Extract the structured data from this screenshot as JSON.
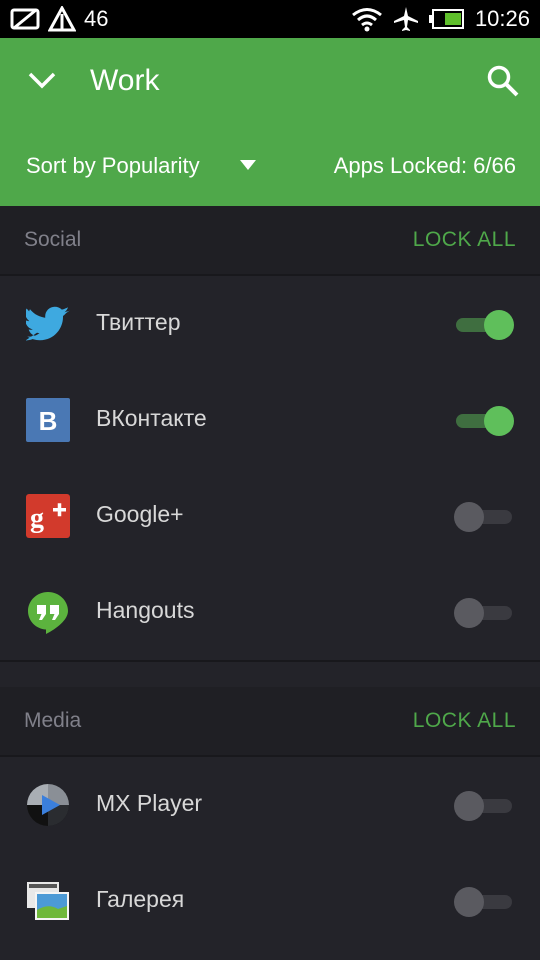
{
  "status_bar": {
    "network": "46",
    "time": "10:26",
    "icons": [
      "screen-off-icon",
      "signal-icon",
      "wifi-icon",
      "airplane-icon",
      "battery-icon"
    ]
  },
  "app_bar": {
    "title": "Work",
    "sort_label": "Sort by Popularity",
    "apps_locked": "Apps Locked: 6/66",
    "color": "#4fa84a"
  },
  "sections": [
    {
      "title": "Social",
      "action": "LOCK ALL",
      "apps": [
        {
          "name": "Твиттер",
          "icon": "twitter-icon",
          "locked": true
        },
        {
          "name": "ВКонтакте",
          "icon": "vk-icon",
          "locked": true
        },
        {
          "name": "Google+",
          "icon": "google-plus-icon",
          "locked": false
        },
        {
          "name": "Hangouts",
          "icon": "hangouts-icon",
          "locked": false
        }
      ]
    },
    {
      "title": "Media",
      "action": "LOCK ALL",
      "apps": [
        {
          "name": "MX Player",
          "icon": "mx-player-icon",
          "locked": false
        },
        {
          "name": "Галерея",
          "icon": "gallery-icon",
          "locked": false
        }
      ]
    }
  ]
}
